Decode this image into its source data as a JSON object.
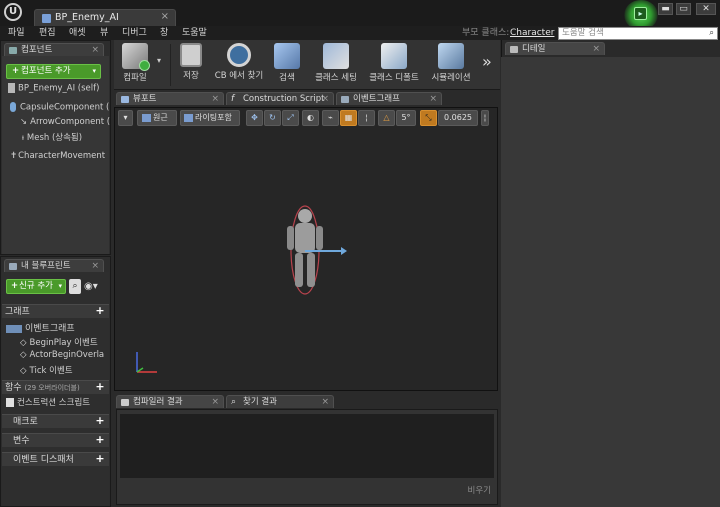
{
  "window": {
    "logo": "U",
    "doc_tab": "BP_Enemy_AI",
    "close_glyph": "×",
    "controls": [
      "▬",
      "▭",
      "✕"
    ]
  },
  "menu": {
    "items": [
      "파일",
      "편집",
      "애셋",
      "뷰",
      "디버그",
      "창",
      "도움말"
    ],
    "parent_class_label": "부모 클래스:",
    "parent_class_value": "Character",
    "help_search_placeholder": "도움말 검색"
  },
  "components_panel": {
    "tab": "컴포넌트",
    "add_button": "컴포넌트 추가",
    "self_item": "BP_Enemy_AI (self)",
    "items": [
      "CapsuleComponent (",
      "ArrowComponent (",
      "Mesh (상속됨)",
      "CharacterMovement"
    ]
  },
  "my_blueprint_panel": {
    "tab": "내 블루프린트",
    "add_button": "신규 추가",
    "sections": {
      "graph": "그래프",
      "event_graph": "이벤트그래프",
      "events": [
        "BeginPlay 이벤트",
        "ActorBeginOverla",
        "Tick 이벤트"
      ],
      "functions": "함수",
      "functions_override": "(29 오버라이더블)",
      "construction_script": "컨스트럭션 스크립트",
      "macros": "매크로",
      "variables": "변수",
      "event_dispatchers": "이벤트 디스패처"
    }
  },
  "toolbar": {
    "buttons": [
      "컴파일",
      "저장",
      "CB 에서 찾기",
      "검색",
      "클래스 세팅",
      "클래스 디폴트",
      "시뮬레이션"
    ],
    "more": "»"
  },
  "editor_tabs": [
    "뷰포트",
    "Construction Script",
    "이벤트그래프"
  ],
  "viewport_toolbar": {
    "perspective": "원근",
    "lighting": "라이팅포함",
    "snap_angle": "5°",
    "scale_snap": "0.0625"
  },
  "bottom_tabs": [
    "컴파일러 결과",
    "찾기 결과"
  ],
  "bottom": {
    "clear_button": "비우기"
  },
  "details_panel": {
    "tab": "디테일"
  },
  "colors": {
    "accent_green": "#4a9a2a",
    "tab_bg": "#3d3d3d",
    "viewport_bg": "#262626"
  }
}
